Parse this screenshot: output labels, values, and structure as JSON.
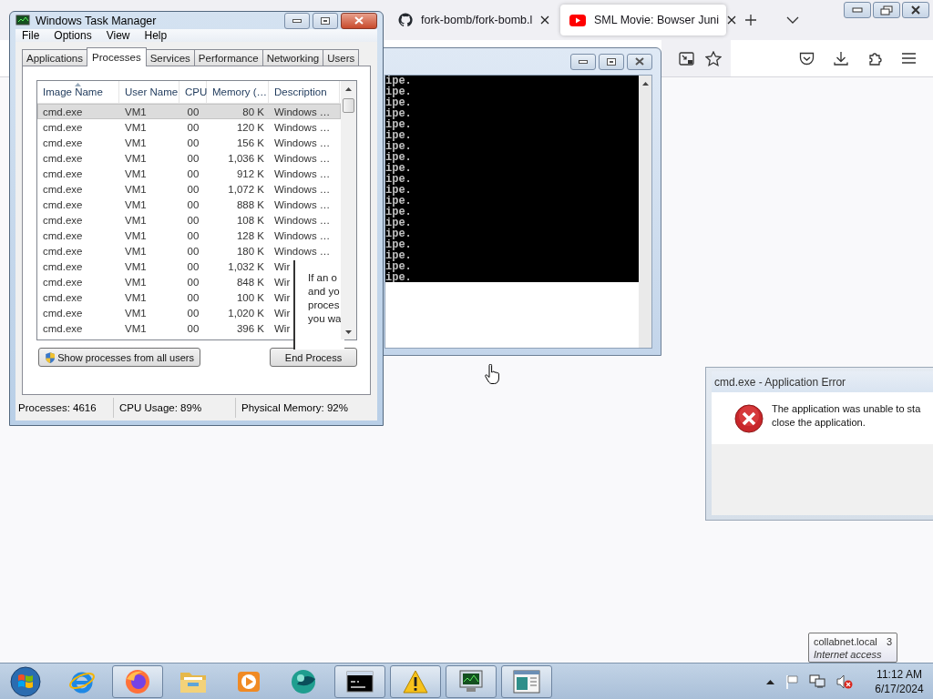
{
  "browser": {
    "tabs": [
      {
        "title": "fork-bomb/fork-bomb.l",
        "selected": false
      },
      {
        "title": "SML Movie: Bowser Juni",
        "selected": true
      }
    ]
  },
  "console": {
    "lines": [
      "ipe.",
      "ipe.",
      "ipe.",
      "ipe.",
      "ipe.",
      "ipe.",
      "ipe.",
      "ipe.",
      "ipe.",
      "ipe.",
      "ipe.",
      "ipe.",
      "ipe.",
      "ipe.",
      "ipe.",
      "ipe.",
      "ipe.",
      "ipe.",
      "ipe."
    ]
  },
  "task_manager": {
    "title": "Windows Task Manager",
    "menu": [
      "File",
      "Options",
      "View",
      "Help"
    ],
    "tabs": [
      {
        "label": "Applications",
        "selected": false
      },
      {
        "label": "Processes",
        "selected": true
      },
      {
        "label": "Services",
        "selected": false
      },
      {
        "label": "Performance",
        "selected": false
      },
      {
        "label": "Networking",
        "selected": false
      },
      {
        "label": "Users",
        "selected": false
      }
    ],
    "columns": [
      "Image Name",
      "User Name",
      "CPU",
      "Memory (…",
      "Description"
    ],
    "rows": [
      {
        "cells": [
          "cmd.exe",
          "VM1",
          "00",
          "80 K",
          "Windows …"
        ],
        "selected": true
      },
      {
        "cells": [
          "cmd.exe",
          "VM1",
          "00",
          "120 K",
          "Windows …"
        ],
        "selected": false
      },
      {
        "cells": [
          "cmd.exe",
          "VM1",
          "00",
          "156 K",
          "Windows …"
        ],
        "selected": false
      },
      {
        "cells": [
          "cmd.exe",
          "VM1",
          "00",
          "1,036 K",
          "Windows …"
        ],
        "selected": false
      },
      {
        "cells": [
          "cmd.exe",
          "VM1",
          "00",
          "912 K",
          "Windows …"
        ],
        "selected": false
      },
      {
        "cells": [
          "cmd.exe",
          "VM1",
          "00",
          "1,072 K",
          "Windows …"
        ],
        "selected": false
      },
      {
        "cells": [
          "cmd.exe",
          "VM1",
          "00",
          "888 K",
          "Windows …"
        ],
        "selected": false
      },
      {
        "cells": [
          "cmd.exe",
          "VM1",
          "00",
          "108 K",
          "Windows …"
        ],
        "selected": false
      },
      {
        "cells": [
          "cmd.exe",
          "VM1",
          "00",
          "128 K",
          "Windows …"
        ],
        "selected": false
      },
      {
        "cells": [
          "cmd.exe",
          "VM1",
          "00",
          "180 K",
          "Windows …"
        ],
        "selected": false
      },
      {
        "cells": [
          "cmd.exe",
          "VM1",
          "00",
          "1,032 K",
          "Wir"
        ],
        "selected": false
      },
      {
        "cells": [
          "cmd.exe",
          "VM1",
          "00",
          "848 K",
          "Wir"
        ],
        "selected": false
      },
      {
        "cells": [
          "cmd.exe",
          "VM1",
          "00",
          "100 K",
          "Wir"
        ],
        "selected": false
      },
      {
        "cells": [
          "cmd.exe",
          "VM1",
          "00",
          "1,020 K",
          "Wir"
        ],
        "selected": false
      },
      {
        "cells": [
          "cmd.exe",
          "VM1",
          "00",
          "396 K",
          "Wir"
        ],
        "selected": false
      }
    ],
    "tooltip": [
      "If an o",
      "and yo",
      "proces",
      "you wa"
    ],
    "buttons": [
      "Show processes from all users",
      "End Process"
    ],
    "status_bar": [
      "Processes: 4616",
      "CPU Usage: 89%",
      "Physical Memory: 92%"
    ]
  },
  "error_dialog": {
    "title": "cmd.exe - Application Error",
    "message": [
      "The application was unable to sta",
      "close the application."
    ]
  },
  "taskbar": {
    "items": [
      {
        "running": false
      },
      {
        "running": true
      },
      {
        "running": false
      },
      {
        "running": false
      },
      {
        "running": false
      },
      {
        "running": true
      },
      {
        "running": true
      },
      {
        "running": true
      },
      {
        "running": true
      }
    ],
    "clock": {
      "time": "11:12 AM",
      "date": "6/17/2024"
    }
  },
  "tray_tooltip": {
    "title": "collabnet.local",
    "count": "3",
    "status": "Internet access"
  }
}
